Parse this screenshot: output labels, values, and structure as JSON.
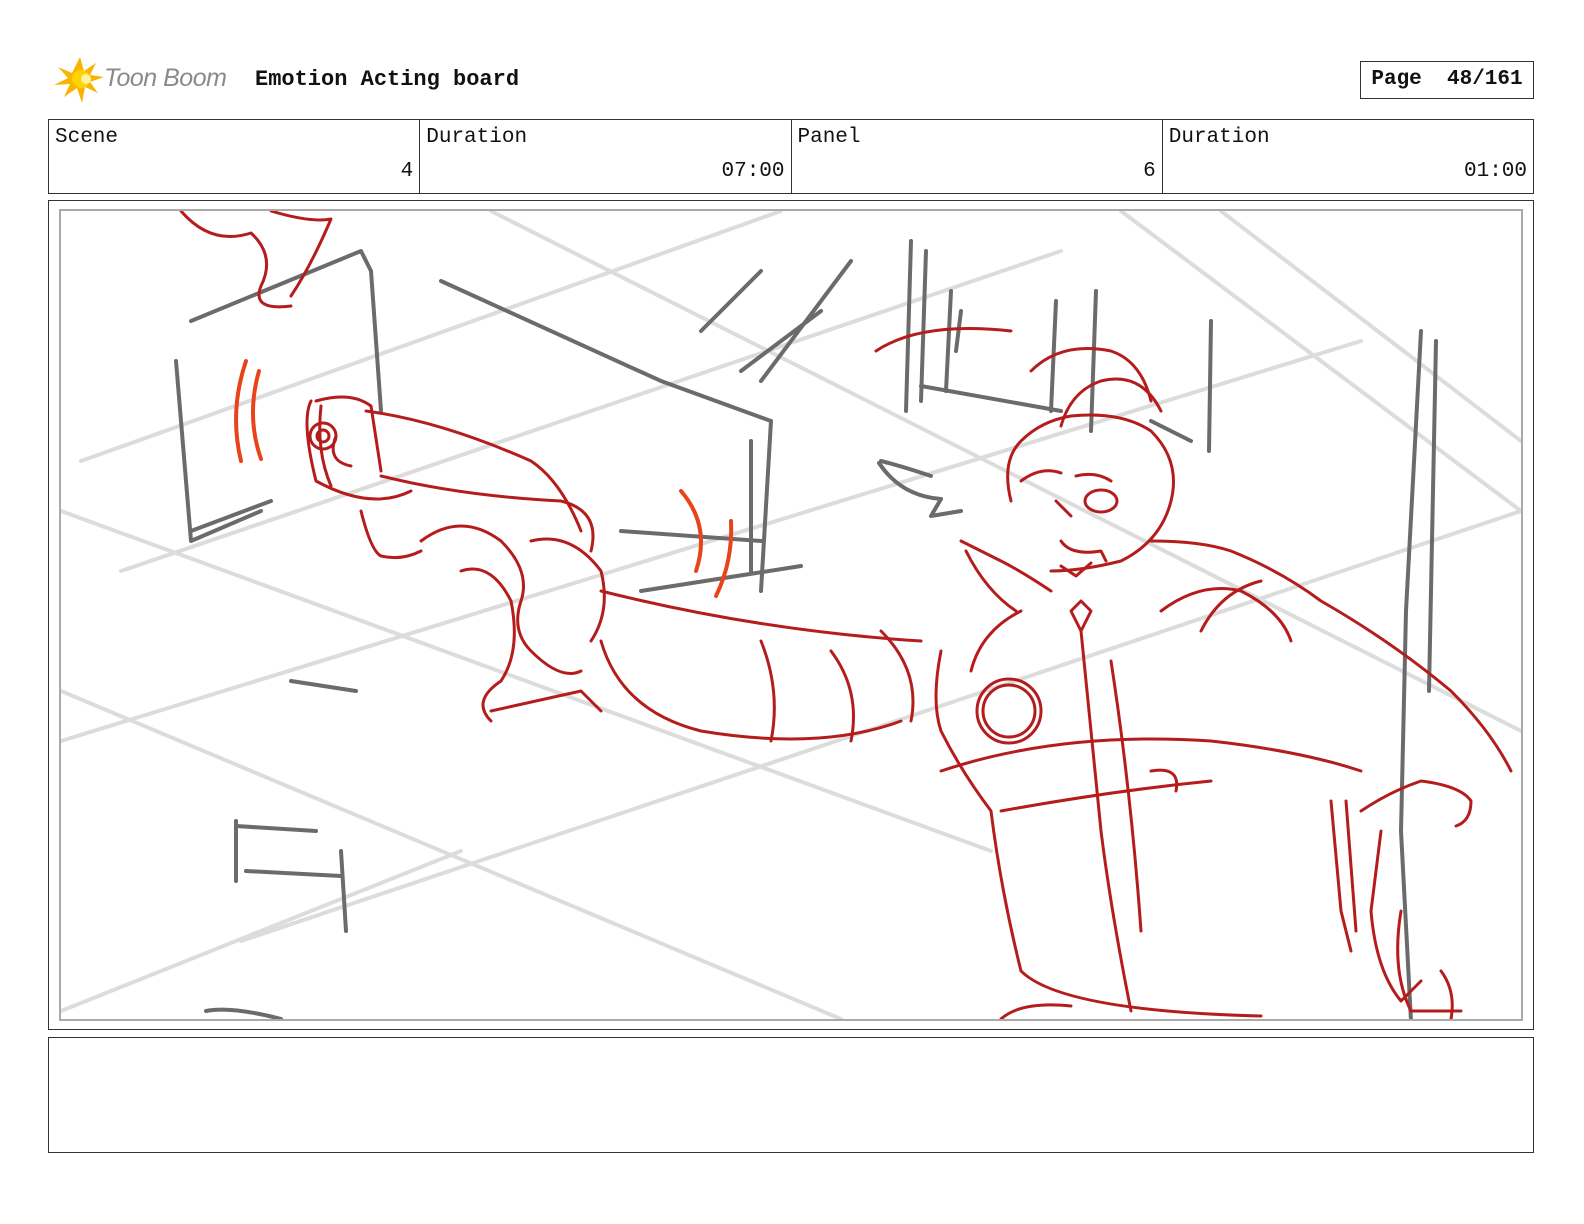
{
  "header": {
    "logo_text": "Toon Boom",
    "title": "Emotion Acting board",
    "page_label": "Page",
    "page_number": "48/161"
  },
  "info": {
    "scene_label": "Scene",
    "scene_value": "4",
    "scene_duration_label": "Duration",
    "scene_duration_value": "07:00",
    "panel_label": "Panel",
    "panel_value": "6",
    "panel_duration_label": "Duration",
    "panel_duration_value": "01:00"
  },
  "panel": {
    "sketch": "sketch-drawing",
    "colors": {
      "rough": "#b51d1d",
      "accent": "#e8431a",
      "background": "#6b6b6b",
      "guides": "#dcdcdc"
    }
  },
  "notes": {
    "text": ""
  }
}
